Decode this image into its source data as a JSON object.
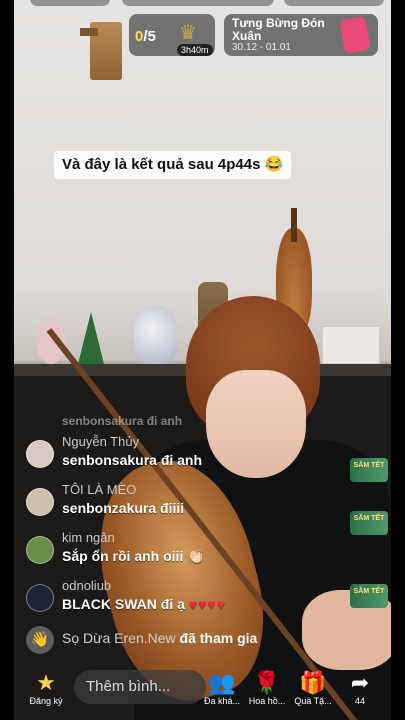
{
  "colors": {
    "accent": "#ffd54a",
    "heart": "#f22a3c",
    "gift": "#ff6fa8",
    "flower": "#e8333a"
  },
  "top": {
    "challenge": {
      "score_current": "0",
      "score_total": "/5",
      "timer": "3h40m",
      "icon": "crown-icon"
    },
    "event": {
      "title": "Tưng Bừng Đón Xuân",
      "dates": "30.12 - 01.01",
      "icon": "phone-gift-icon"
    }
  },
  "caption": "Và đây là kết quả sau 4p44s 😂",
  "chat": {
    "messages": [
      {
        "user": "",
        "text": "senbonsakura đi anh",
        "faded": true
      },
      {
        "user": "Nguyễn Thủy",
        "text": "senbonsakura đi anh"
      },
      {
        "user": "TÔI LÀ MÈO",
        "text": "senbonzakura điiii"
      },
      {
        "user": "kim ngân",
        "text": "Sắp ổn rồi anh oiii 👏🏻"
      },
      {
        "user": "odnoliub",
        "text": "BLACK SWAN đi ạ",
        "hearts": "♥♥♥♥"
      }
    ],
    "joined": {
      "name": "Sọ Dừa Eren.New",
      "text": " đã tham gia",
      "icon": "wave-hand-icon"
    }
  },
  "side_tags": [
    "SĂM TẾT",
    "SĂM TẾT",
    "SĂM TẾT"
  ],
  "bottom": {
    "subscribe_label": "Đăng ký",
    "comment_placeholder": "Thêm bình...",
    "multi_guest_label": "Đa khá...",
    "flower_label": "Hoa hồ...",
    "gift_label": "Quà Tặ...",
    "share_count": "44"
  }
}
